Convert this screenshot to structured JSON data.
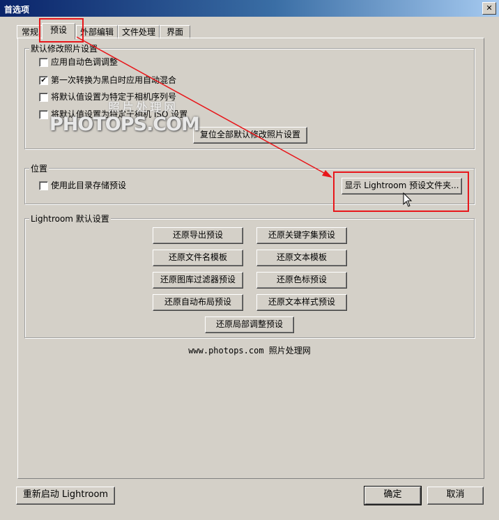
{
  "window": {
    "title": "首选项"
  },
  "tabs": [
    {
      "label": "常规"
    },
    {
      "label": "预设",
      "active": true
    },
    {
      "label": "外部编辑"
    },
    {
      "label": "文件处理"
    },
    {
      "label": "界面"
    }
  ],
  "default_develop": {
    "legend": "默认修改照片设置",
    "checkboxes": [
      {
        "label": "应用自动色调调整",
        "checked": false
      },
      {
        "label": "第一次转换为黑白时应用自动混合",
        "checked": true
      },
      {
        "label": "将默认值设置为特定于相机序列号",
        "checked": false
      },
      {
        "label": "将默认值设置为特定于相机 ISO 设置",
        "checked": false
      }
    ],
    "reset_button": "复位全部默认修改照片设置"
  },
  "location": {
    "legend": "位置",
    "checkbox_label": "使用此目录存储预设",
    "checkbox_checked": false,
    "show_folder_button": "显示 Lightroom 预设文件夹..."
  },
  "lightroom_defaults": {
    "legend": "Lightroom 默认设置",
    "buttons": [
      "还原导出预设",
      "还原关键字集预设",
      "还原文件名模板",
      "还原文本模板",
      "还原图库过滤器预设",
      "还原色标预设",
      "还原自动布局预设",
      "还原文本样式预设",
      "还原局部调整预设"
    ]
  },
  "watermark": {
    "cn": "照片处理网",
    "en": "PHOTOPS.COM"
  },
  "footer_text": "www.photops.com 照片处理网",
  "bottom": {
    "restart_button": "重新启动 Lightroom",
    "ok_button": "确定",
    "cancel_button": "取消"
  },
  "colors": {
    "annotation_red": "#e8161a",
    "dialog_bg": "#d4d0c8",
    "title_blue": "#0a246a"
  },
  "icons": {
    "close": "close-icon",
    "cursor": "mouse-pointer-icon",
    "check": "checkmark-icon"
  }
}
